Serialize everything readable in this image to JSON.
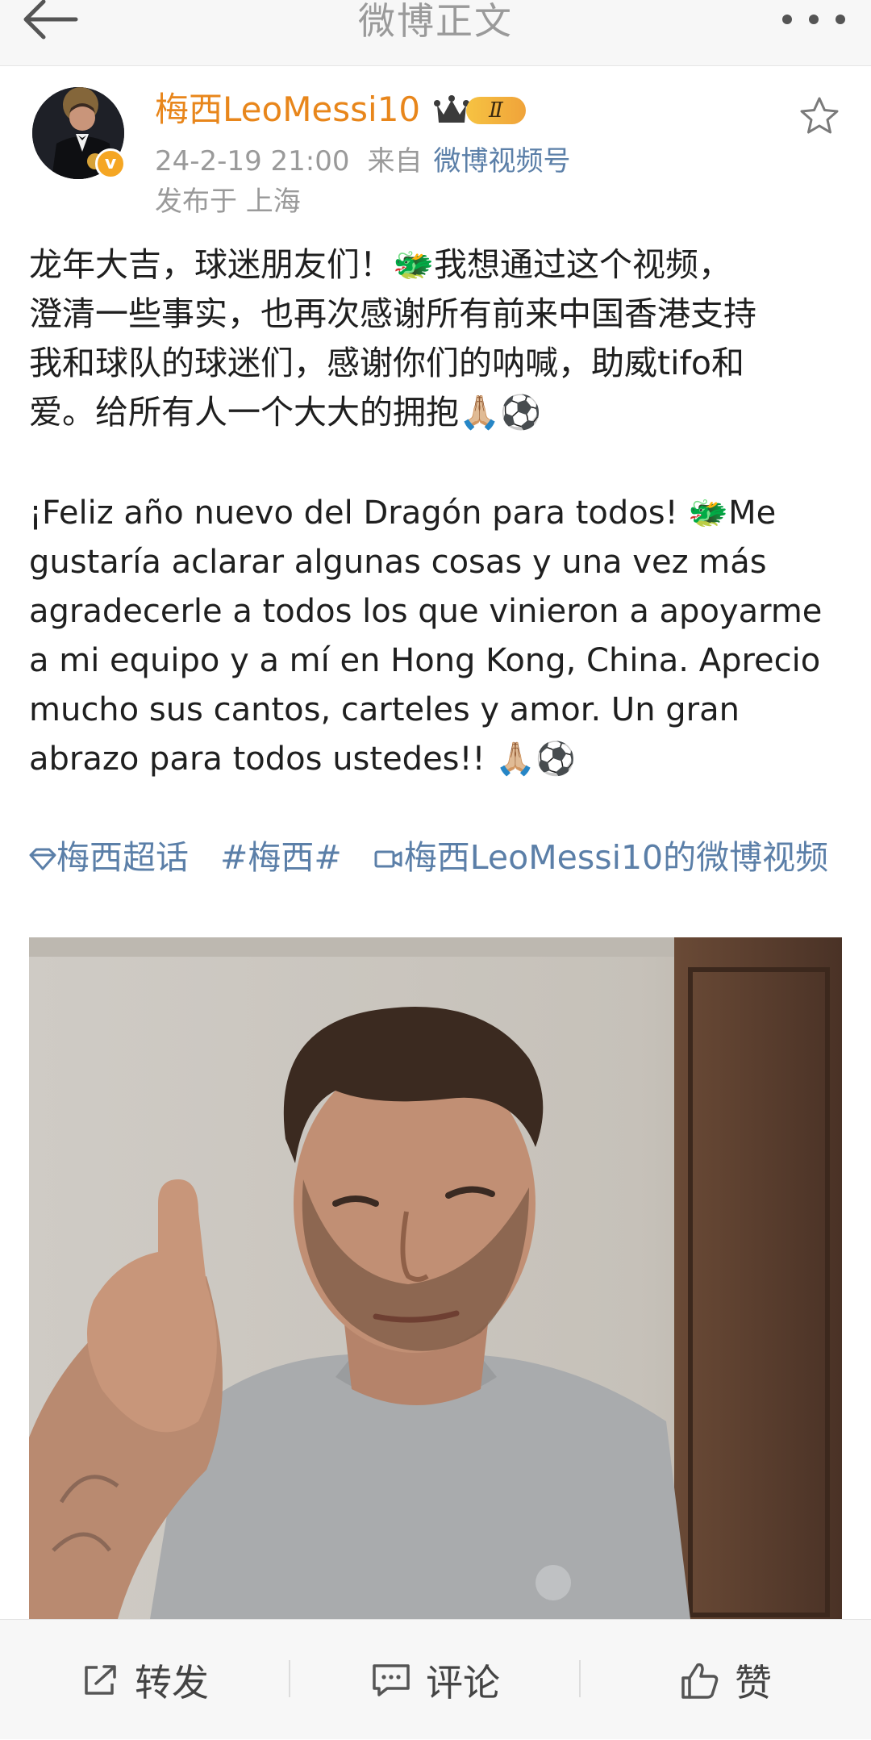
{
  "header": {
    "title": "微博正文",
    "back_icon": "back-arrow-icon",
    "more_icon": "more-dots-icon"
  },
  "author": {
    "name": "梅西LeoMessi10",
    "badge": "Ⅱ",
    "verified_icon": "verified-v-icon"
  },
  "meta": {
    "date": "24-2-19 21:00",
    "source_prefix": "来自",
    "source": "微博视频号",
    "location": "发布于 上海"
  },
  "post": {
    "text_cn": "龙年大吉，球迷朋友们！🐲我想通过这个视频，\n澄清一些事实，也再次感谢所有前来中国香港支持\n我和球队的球迷们，感谢你们的呐喊，助威tifo和\n爱。给所有人一个大大的拥抱🙏🏼⚽",
    "text_es": "¡Feliz año nuevo del Dragón para todos! 🐲Me\ngustaría aclarar algunas cosas y una vez más\nagradecerle a todos los que vinieron a apoyarme\na mi equipo y a mí en Hong Kong, China. Aprecio\nmucho sus cantos, carteles y amor. Un gran\nabrazo para todos ustedes!! 🙏🏼⚽"
  },
  "tags": {
    "super_topic": "梅西超话",
    "hashtag": "#梅西#",
    "video_link": "梅西LeoMessi10的微博视频"
  },
  "actions": {
    "repost": "转发",
    "comment": "评论",
    "like": "赞"
  },
  "colors": {
    "accent_orange": "#e8861b",
    "link_blue": "#5b7fa8",
    "muted_gray": "#9a9a9a"
  }
}
